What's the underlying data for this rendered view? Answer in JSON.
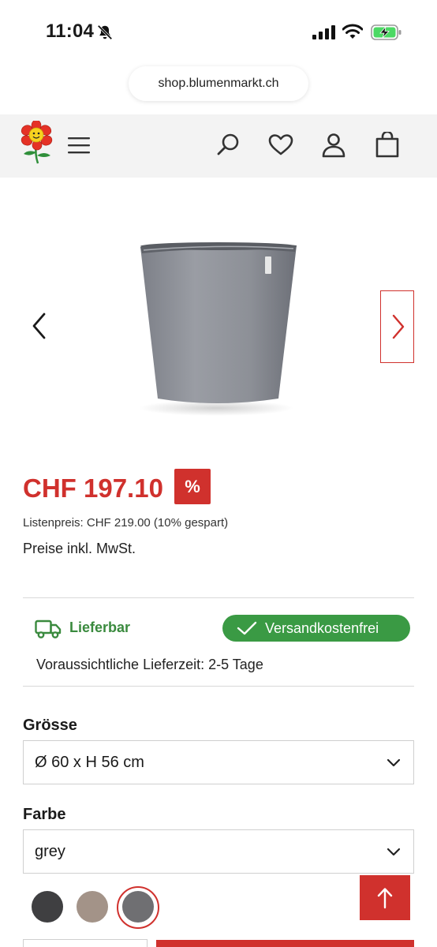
{
  "status_bar": {
    "time": "11:04",
    "icons": [
      "bell-off-icon",
      "cellular-signal-icon",
      "wifi-icon",
      "battery-charging-icon"
    ]
  },
  "browser": {
    "url": "shop.blumenmarkt.ch"
  },
  "header": {
    "icons": [
      "flower-logo",
      "hamburger-menu-icon",
      "search-icon",
      "heart-icon",
      "user-icon",
      "shopping-bag-icon"
    ]
  },
  "gallery": {
    "image": "grey-conical-plant-pot",
    "prev_icon": "chevron-left-icon",
    "next_icon": "chevron-right-icon"
  },
  "product": {
    "price": "CHF 197.10",
    "sale_badge": "%",
    "list_price": "Listenpreis: CHF 219.00 (10% gespart)",
    "vat_note": "Preise inkl. MwSt."
  },
  "shipping": {
    "availability": "Lieferbar",
    "free_shipping": "Versandkostenfrei",
    "delivery_time": "Voraussichtliche Lieferzeit: 2-5 Tage"
  },
  "options": {
    "size_label": "Grösse",
    "size_value": "Ø 60 x H 56 cm",
    "color_label": "Farbe",
    "color_value": "grey",
    "swatches": [
      {
        "color": "#3f3f41",
        "selected": false
      },
      {
        "color": "#a39388",
        "selected": false
      },
      {
        "color": "#6f6f72",
        "selected": true
      }
    ]
  },
  "colors": {
    "accent_red": "#d0312d",
    "success_green": "#3a9a44",
    "header_bg": "#f3f3f3"
  }
}
